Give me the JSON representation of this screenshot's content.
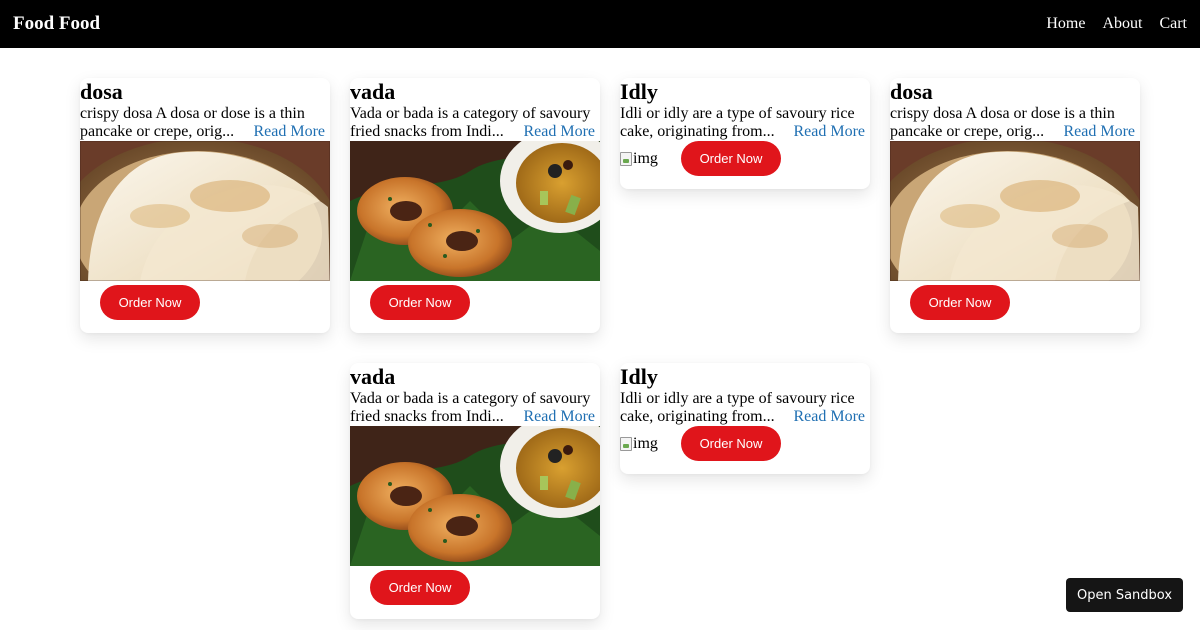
{
  "navbar": {
    "brand": "Food Food",
    "links": [
      "Home",
      "About",
      "Cart"
    ]
  },
  "cards": [
    {
      "title": "dosa",
      "description": "crispy dosa A dosa or dose is a thin pancake or crepe, orig...",
      "read_more": "Read More",
      "image": "dosa",
      "order_label": "Order Now"
    },
    {
      "title": "vada",
      "description": "Vada or bada is a category of savoury fried snacks from Indi...",
      "read_more": "Read More",
      "image": "vada",
      "order_label": "Order Now"
    },
    {
      "title": "Idly",
      "description": "Idli or idly are a type of savoury rice cake, originating from...",
      "read_more": "Read More",
      "image_alt": "img",
      "order_label": "Order Now"
    },
    {
      "title": "dosa",
      "description": "crispy dosa A dosa or dose is a thin pancake or crepe, orig...",
      "read_more": "Read More",
      "image": "dosa",
      "order_label": "Order Now"
    },
    {
      "title": "vada",
      "description": "Vada or bada is a category of savoury fried snacks from Indi...",
      "read_more": "Read More",
      "image": "vada",
      "order_label": "Order Now"
    },
    {
      "title": "Idly",
      "description": "Idli or idly are a type of savoury rice cake, originating from...",
      "read_more": "Read More",
      "image_alt": "img",
      "order_label": "Order Now"
    }
  ],
  "sandbox_label": "Open Sandbox",
  "colors": {
    "accent": "#e0151b",
    "link": "#1f6fb2",
    "navbar": "#000000"
  }
}
